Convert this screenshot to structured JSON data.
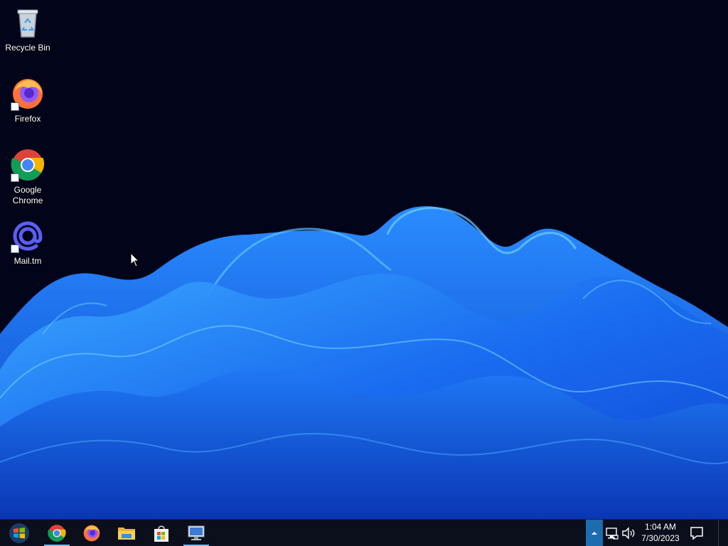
{
  "desktop": {
    "icons": [
      {
        "label": "Recycle Bin",
        "icon": "recycle-bin-icon"
      },
      {
        "label": "Firefox",
        "icon": "firefox-icon",
        "shortcut": true
      },
      {
        "label": "Google Chrome",
        "icon": "chrome-icon",
        "shortcut": true
      },
      {
        "label": "Mail.tm",
        "icon": "mail-at-icon",
        "shortcut": true
      }
    ]
  },
  "taskbar": {
    "start": {
      "icon": "windows-logo-icon"
    },
    "pinned": [
      {
        "name": "Google Chrome",
        "icon": "chrome-icon",
        "active": true
      },
      {
        "name": "Firefox",
        "icon": "firefox-icon",
        "active": false
      },
      {
        "name": "File Explorer",
        "icon": "folder-icon",
        "active": false
      },
      {
        "name": "Microsoft Store",
        "icon": "store-bag-icon",
        "active": false
      },
      {
        "name": "Remote Desktop",
        "icon": "remote-desktop-icon",
        "active": true
      }
    ],
    "tray": {
      "expand_icon": "chevron-up-icon",
      "network_icon": "network-icon",
      "volume_icon": "volume-icon",
      "time": "1:04 AM",
      "date": "7/30/2023",
      "notification_icon": "notification-icon"
    }
  },
  "colors": {
    "background": "#02051a",
    "wave_dark": "#0b3fc8",
    "wave_mid": "#1a6cf0",
    "wave_light": "#38a8ff",
    "taskbar": "#0a0f1b",
    "tray_highlight": "#1e6cb0"
  }
}
